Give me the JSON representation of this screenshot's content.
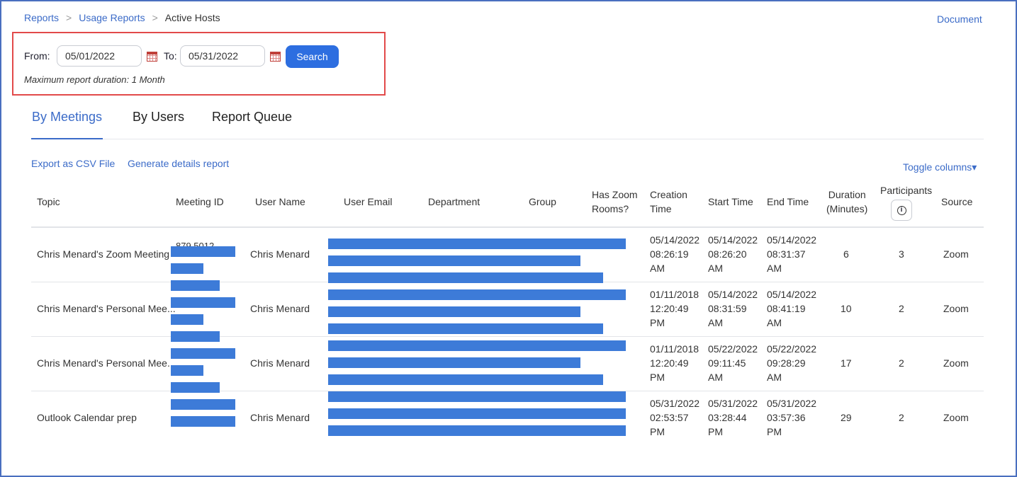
{
  "breadcrumb": {
    "item1": "Reports",
    "item2": "Usage Reports",
    "item3": "Active Hosts",
    "sep": ">"
  },
  "document_link": "Document",
  "filters": {
    "from_label": "From:",
    "from_value": "05/01/2022",
    "to_label": "To:",
    "to_value": "05/31/2022",
    "search_label": "Search",
    "max_note": "Maximum report duration: 1 Month"
  },
  "tabs": {
    "by_meetings": "By Meetings",
    "by_users": "By Users",
    "report_queue": "Report Queue"
  },
  "actions": {
    "export_csv": "Export as CSV File",
    "generate_details": "Generate details report",
    "toggle_columns": "Toggle columns▾"
  },
  "columns": {
    "topic": "Topic",
    "meeting_id": "Meeting ID",
    "user_name": "User Name",
    "user_email": "User Email",
    "department": "Department",
    "group": "Group",
    "has_zoom_rooms_1": "Has Zoom",
    "has_zoom_rooms_2": "Rooms?",
    "creation_1": "Creation",
    "creation_2": "Time",
    "start_time": "Start Time",
    "end_time": "End Time",
    "duration_1": "Duration",
    "duration_2": "(Minutes)",
    "participants": "Participants",
    "source": "Source"
  },
  "partial_meeting_id": "879 5012",
  "rows": [
    {
      "topic": "Chris Menard's Zoom Meeting",
      "user_name": "Chris Menard",
      "creation": [
        "05/14/2022",
        "08:26:19",
        "AM"
      ],
      "start": [
        "05/14/2022",
        "08:26:20",
        "AM"
      ],
      "end": [
        "05/14/2022",
        "08:31:37",
        "AM"
      ],
      "duration": "6",
      "participants": "3",
      "source": "Zoom"
    },
    {
      "topic": "Chris Menard's Personal Mee...",
      "user_name": "Chris Menard",
      "creation": [
        "01/11/2018",
        "12:20:49",
        "PM"
      ],
      "start": [
        "05/14/2022",
        "08:31:59",
        "AM"
      ],
      "end": [
        "05/14/2022",
        "08:41:19",
        "AM"
      ],
      "duration": "10",
      "participants": "2",
      "source": "Zoom"
    },
    {
      "topic": "Chris Menard's Personal Mee...",
      "user_name": "Chris Menard",
      "creation": [
        "01/11/2018",
        "12:20:49",
        "PM"
      ],
      "start": [
        "05/22/2022",
        "09:11:45",
        "AM"
      ],
      "end": [
        "05/22/2022",
        "09:28:29",
        "AM"
      ],
      "duration": "17",
      "participants": "2",
      "source": "Zoom"
    },
    {
      "topic": "Outlook Calendar prep",
      "user_name": "Chris Menard",
      "creation": [
        "05/31/2022",
        "02:53:57",
        "PM"
      ],
      "start": [
        "05/31/2022",
        "03:28:44",
        "PM"
      ],
      "end": [
        "05/31/2022",
        "03:57:36",
        "PM"
      ],
      "duration": "29",
      "participants": "2",
      "source": "Zoom"
    }
  ],
  "colors": {
    "link": "#3b6bc8",
    "button": "#2d6ee0",
    "redaction": "#3d7bd8",
    "highlight": "#e24a4a"
  }
}
